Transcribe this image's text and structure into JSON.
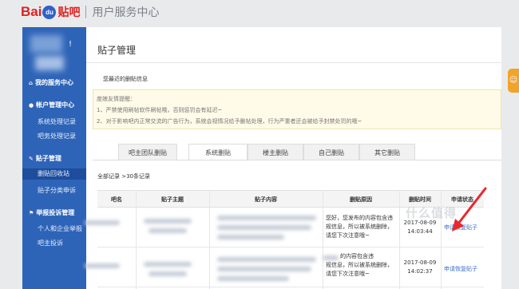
{
  "header": {
    "logo_bai": "Bai",
    "logo_du": "du",
    "logo_tieba": "贴吧",
    "center_title": "用户服务中心"
  },
  "sidebar": {
    "avatar_mark": "!",
    "my_service": "我的服务中心",
    "account_mgmt": "帐户管理中心",
    "account_items": [
      "系统处理记录",
      "吧务处理记录"
    ],
    "post_mgmt": "贴子管理",
    "post_items": [
      "删贴回收站",
      "贴子分类申诉"
    ],
    "report_mgmt": "举报投诉管理",
    "report_items": [
      "个人和企业举报",
      "吧主投诉"
    ],
    "active_item": "删贴回收站"
  },
  "main": {
    "title": "贴子管理",
    "recent_label": "您最近的删贴信息",
    "notice": {
      "heading": "度娘友情提醒：",
      "line1": "1、严禁使用刷帖软件刷帖哦，否则惩罚会有延迟~",
      "line2": "2、对于影响吧内正常交流的广告行为，系统会视情况给予删帖处理，行为严重者还会被给予封禁处罚的哦~"
    },
    "tabs": [
      "吧主团队删贴",
      "系统删贴",
      "楼主删贴",
      "自己删贴",
      "其它删贴"
    ],
    "active_tab": "系统删贴",
    "record_count": "全部记录 >30条记录",
    "table": {
      "headers": [
        "吧名",
        "贴子主题",
        "贴子内容",
        "删贴原因",
        "删贴时间",
        "申请状态"
      ],
      "rows": [
        {
          "reason": [
            "您好，您发布的内容包含违",
            "规信息，所以被系统删除，",
            "请您下次注意哦~"
          ],
          "date": "2017-08-09",
          "time": "14:03:44",
          "apply": "申请恢复贴子"
        },
        {
          "reason": [
            "的内容包含违",
            "规信息，所以被系统删除，",
            "请您下次注意哦~"
          ],
          "date": "2017-08-09",
          "time": "14:02:37",
          "apply": "申请恢复贴子"
        }
      ]
    }
  },
  "colors": {
    "sidebar_bg": "#2e64b8",
    "brand_red": "#e02020",
    "link_blue": "#3b6fd0",
    "arrow_red": "#e8282e",
    "notice_bg": "#fffbe8"
  },
  "watermark": "什么值得"
}
